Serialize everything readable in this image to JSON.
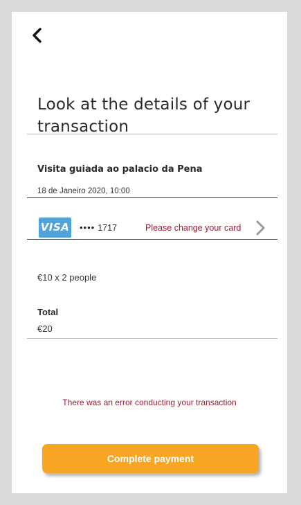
{
  "header": {
    "back_icon": "chevron-left-icon"
  },
  "page": {
    "title": "Look at the details of your transaction"
  },
  "event": {
    "name": "Visita guiada ao palacio da Pena",
    "date": "18 de Janeiro 2020, 10:00"
  },
  "card": {
    "brand": "VISA",
    "masked_dots": "••••",
    "last4": "1717",
    "warning": "Please change your card",
    "arrow_icon": "chevron-right-icon"
  },
  "pricing": {
    "line": "€10 x 2 people",
    "total_label": "Total",
    "total_value": "€20"
  },
  "error_message": "There was an error conducting your transaction",
  "actions": {
    "pay_label": "Complete payment"
  },
  "colors": {
    "accent": "#f6a623",
    "error": "#9a1b2e",
    "visa": "#4fa3d8"
  }
}
